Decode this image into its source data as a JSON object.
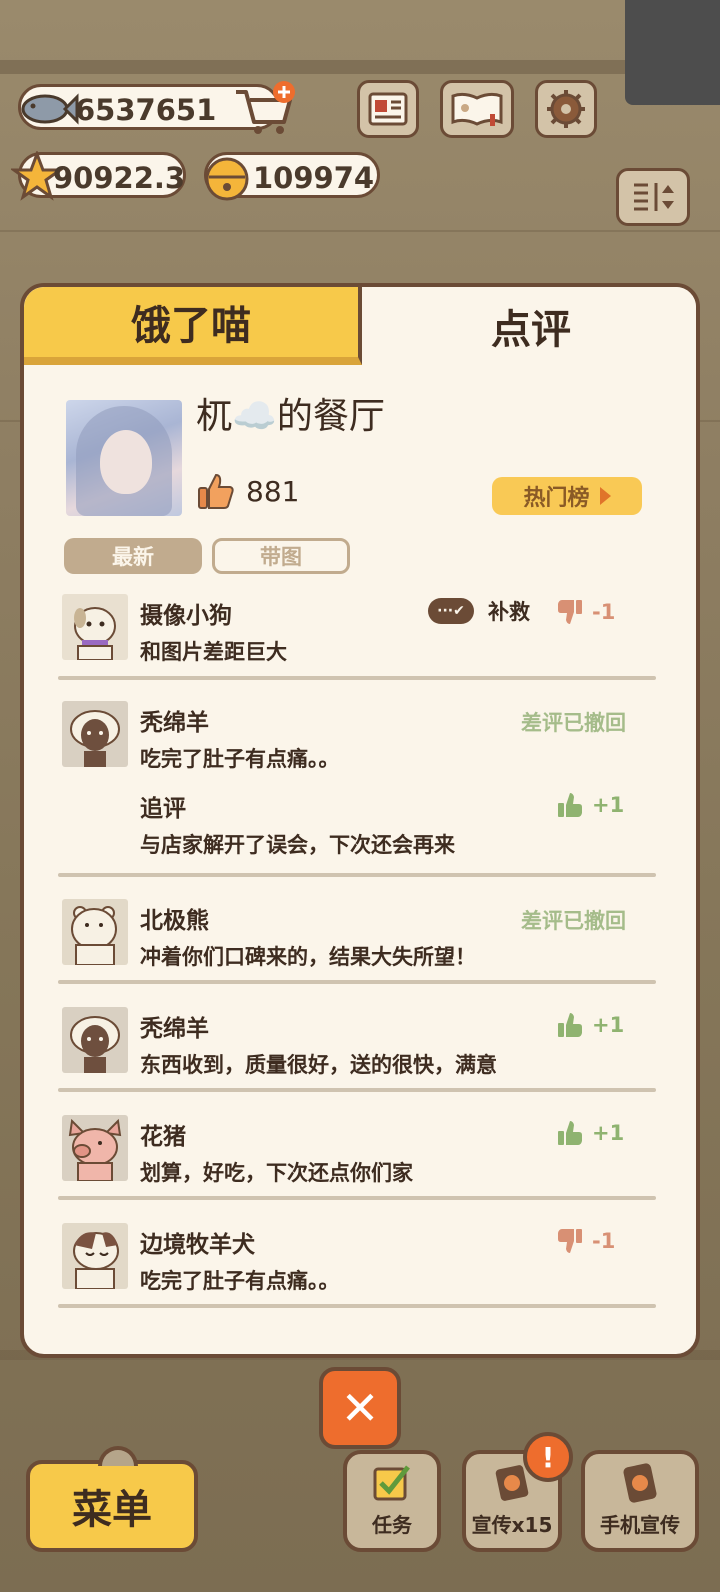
{
  "hud": {
    "fish": "6537651",
    "stars": "90922.3",
    "bells": "109974"
  },
  "tabs": {
    "left": "饿了喵",
    "right": "点评"
  },
  "profile": {
    "name": "杌☁️的餐厅",
    "likes": "881",
    "hot_label": "热门榜"
  },
  "filters": {
    "newest": "最新",
    "with_image": "带图"
  },
  "reviews": [
    {
      "name": "摄像小狗",
      "text": "和图片差距巨大",
      "remedy": "补救",
      "score": "-1"
    },
    {
      "name": "秃绵羊",
      "text": "吃完了肚子有点痛。。",
      "status": "差评已撤回",
      "followup_label": "追评",
      "followup_text": "与店家解开了误会，下次还会再来",
      "score": "+1"
    },
    {
      "name": "北极熊",
      "text": "冲着你们口碑来的，结果大失所望！",
      "status": "差评已撤回"
    },
    {
      "name": "秃绵羊",
      "text": "东西收到，质量很好，送的很快，满意",
      "score": "+1"
    },
    {
      "name": "花猪",
      "text": "划算，好吃，下次还点你们家",
      "score": "+1"
    },
    {
      "name": "边境牧羊犬",
      "text": "吃完了肚子有点痛。。",
      "score": "-1"
    }
  ],
  "bottom": {
    "menu": "菜单",
    "tasks": "任务",
    "promo": "宣传x15",
    "phone_promo": "手机宣传",
    "badge": "!"
  },
  "colors": {
    "accent": "#f7c94a",
    "close": "#ee6d2d",
    "outline": "#6b4b36",
    "positive": "#8fb370",
    "negative": "#d89074"
  }
}
